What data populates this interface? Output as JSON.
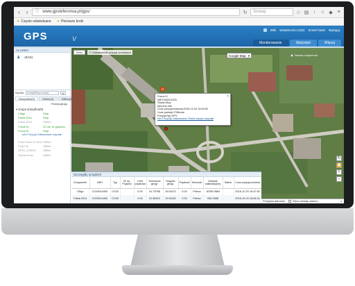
{
  "browser": {
    "url": "www.gpsteferonsa.pl/gps/",
    "search_placeholder": "Szukaj",
    "bookmarks": [
      "Często odwiedzane",
      "Pierwsze kroki"
    ]
  },
  "app": {
    "logo": "GPS",
    "logo_suffix": "V",
    "top_links": [
      "Wiki",
      "Wiadomości (182)",
      "Zmień hasło",
      "Wyloguj"
    ],
    "tabs": [
      "Monitorowanie",
      "Statystyki",
      "Więcej"
    ],
    "active_tab": "Monitorowanie"
  },
  "left_panel": {
    "alarms_title": "ALARMY",
    "alarm_count": "(5/16)",
    "filter_label": "Wyniki:",
    "filter_placeholder": "Dodaj/filtruj szukaj",
    "filter_button": "x",
    "status_tabs": [
      "Wszystkie(9)",
      "Online(4)",
      "Offline(5)"
    ],
    "add_group": "+Dodaj grupę",
    "group_title": "Grupa domyślna(9)",
    "devices": [
      {
        "name": "Citigo",
        "status": "Stop",
        "cls": "ok"
      },
      {
        "name": "Fabia 2014",
        "status": "Stop",
        "cls": "ok"
      },
      {
        "name": "Fabia 2013",
        "status": "Offline",
        "cls": "gray"
      },
      {
        "name": "Focus III",
        "status": "22 dni 14 godzina",
        "cls": "ok"
      },
      {
        "name": "Focus III",
        "status": "Stop",
        "cls": "ok"
      },
      {
        "name": "Ford Focus III 2015",
        "status": "Offline",
        "cls": "gray"
      },
      {
        "name": "Ford Fie",
        "status": "Offline",
        "cls": "gray"
      },
      {
        "name": "OPEL CORSA",
        "status": "Offline",
        "cls": "gray"
      },
      {
        "name": "Toyota Auris",
        "status": "Offline",
        "cls": "gray"
      }
    ],
    "detail_links": "Info  Pozycja  Odtwarzanie  więcej▾"
  },
  "map": {
    "play_button": "Wróć",
    "show_position": "Odświeżanie pozycji za sekund",
    "map_type": "Google Map",
    "new_devices": "Nazwa urządzenia",
    "popup": {
      "lines": [
        "Focus III",
        "IMEI:000201400",
        "Status:Stop",
        "Akcumu.Info",
        "Czas pozycjonowania:2016-12-20 16:40:52",
        "Czas postoju:17Minuta",
        "Pozycja typ:GPS"
      ],
      "links": "Info  Pozycja  Odtwarzanie  Strefa zakazu  więcej▾"
    },
    "zoom_in": "+",
    "zoom_out": "−"
  },
  "devices_table": {
    "title": "Szczegóły urządzeń",
    "columns": [
      "Urządzenie",
      "IMEI",
      "Typ",
      "Nr rej. Pojazdu",
      "Limit prędkości",
      "Szerokość geogr.",
      "Długość geogr.",
      "Prędkość",
      "Kierunek",
      "Dystans całkowity(km)",
      "Status",
      "Czas pozycjonowania"
    ],
    "rows": [
      [
        "Citigo",
        "CC00014400",
        "CC00",
        "",
        "0.00",
        "51.75768",
        "19.53472",
        "0.00",
        "Północ",
        "16789.9564",
        "",
        "2016-12-20 16:47:39"
      ],
      [
        "Fabia 2014",
        "CC00014400",
        "CC00",
        "",
        "0.00",
        "51.86313",
        "19.51182",
        "0.00",
        "Północ",
        "535.3388",
        "",
        "2016-12-20 16:28:16"
      ]
    ]
  },
  "alarms_bar": {
    "label": "Przegląd alarmów",
    "checkbox_label": "Wycz dźwięk alarmu"
  }
}
